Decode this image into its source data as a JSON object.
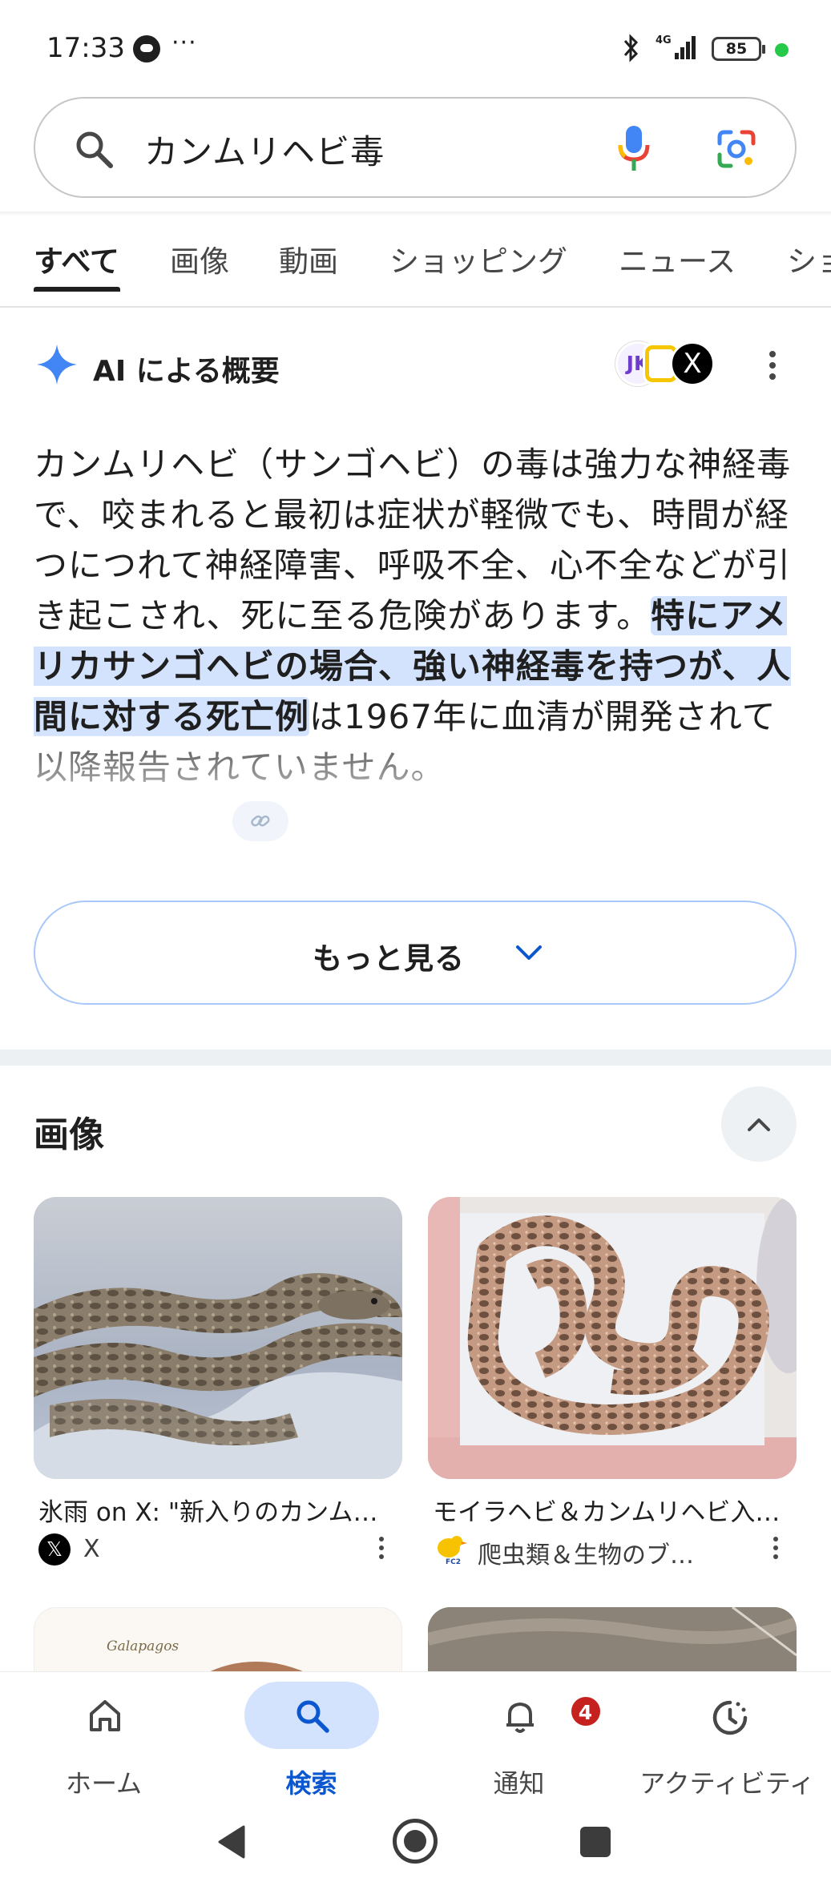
{
  "status_bar": {
    "time": "17:33",
    "dots": "···",
    "battery": "85",
    "network": "4G"
  },
  "search": {
    "query": "カンムリヘビ毒"
  },
  "tabs": [
    {
      "label": "すべて",
      "active": true
    },
    {
      "label": "画像"
    },
    {
      "label": "動画"
    },
    {
      "label": "ショッピング"
    },
    {
      "label": "ニュース"
    },
    {
      "label": "ショ"
    }
  ],
  "ai_overview": {
    "title": "AI による概要",
    "source_avatars": [
      "JK",
      "X"
    ],
    "text_before": "カンムリヘビ（サンゴヘビ）の毒は強力な神経毒で、咬まれると最初は症状が軽微でも、時間が経つにつれて神経障害、呼吸不全、心不全などが引き起こされ、死に至る危険があります。",
    "text_highlight": "特にアメリカサンゴヘビの場合、強い神経毒を持つが、人間に対する死亡例",
    "text_after_1": "は",
    "text_after_2": "1967年に血清が開発されて以降報告されていません。",
    "more_label": "もっと見る"
  },
  "images_section": {
    "title": "画像",
    "cards": [
      {
        "caption": "氷雨 on X: \"新入りのカンム…",
        "source": "X"
      },
      {
        "caption": "モイラヘビ＆カンムリヘビ入…",
        "source": "爬虫類＆生物のブ…"
      }
    ],
    "partial_logo": "Galapagos"
  },
  "bottom_nav": [
    {
      "label": "ホーム",
      "icon": "home-icon"
    },
    {
      "label": "検索",
      "icon": "search-icon",
      "active": true
    },
    {
      "label": "通知",
      "icon": "bell-icon",
      "badge": "4"
    },
    {
      "label": "アクティビティ",
      "icon": "activity-icon"
    }
  ],
  "colors": {
    "accent": "#0b57d0",
    "highlight": "#d3e3fd",
    "badge": "#c5221f"
  }
}
